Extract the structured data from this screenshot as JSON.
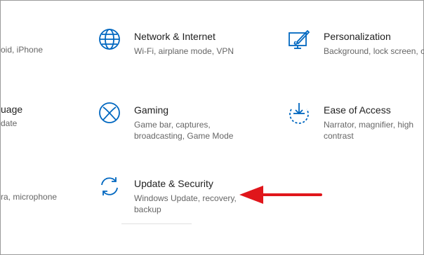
{
  "left_column": {
    "row1_desc_fragment": "oid, iPhone",
    "row2_title_fragment": "uage",
    "row2_desc_fragment": "date",
    "row3_desc_fragment": "ra, microphone"
  },
  "tiles": [
    {
      "title": "Network & Internet",
      "desc": "Wi-Fi, airplane mode, VPN",
      "icon": "globe-icon"
    },
    {
      "title": "Personalization",
      "desc": "Background, lock screen, c",
      "icon": "paintbrush-icon"
    },
    {
      "title": "Gaming",
      "desc": "Game bar, captures, broadcasting, Game Mode",
      "icon": "xbox-icon"
    },
    {
      "title": "Ease of Access",
      "desc": "Narrator, magnifier, high contrast",
      "icon": "ease-of-access-icon"
    },
    {
      "title": "Update & Security",
      "desc": "Windows Update, recovery, backup",
      "icon": "sync-icon"
    }
  ],
  "colors": {
    "accent": "#0067c0",
    "arrow": "#e0161b"
  }
}
